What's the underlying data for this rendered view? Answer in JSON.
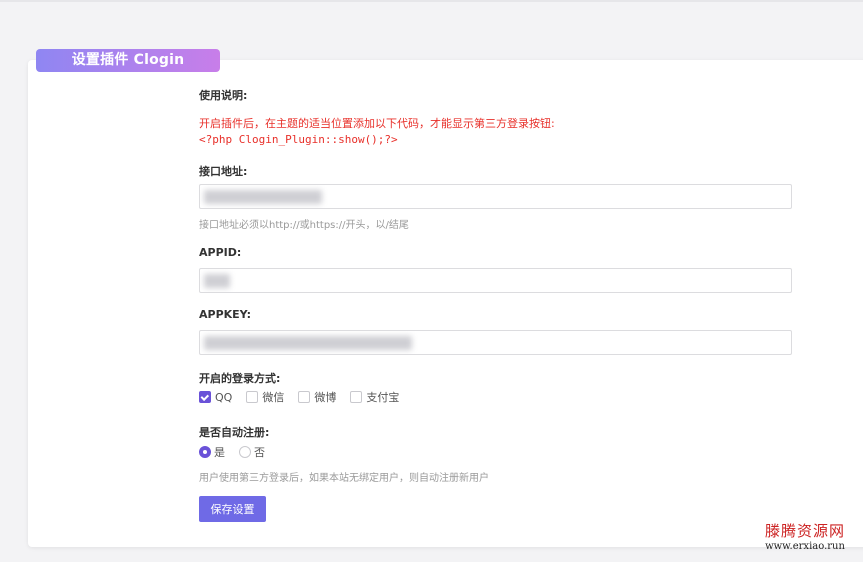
{
  "panel": {
    "title": "设置插件 Clogin"
  },
  "usage": {
    "label": "使用说明:",
    "notice": "开启插件后，在主题的适当位置添加以下代码，才能显示第三方登录按钮:",
    "code": "<?php Clogin_Plugin::show();?>"
  },
  "api_url": {
    "label": "接口地址:",
    "value": "",
    "help": "接口地址必须以http://或https://开头，以/结尾"
  },
  "appid": {
    "label": "APPID:",
    "value": ""
  },
  "appkey": {
    "label": "APPKEY:",
    "value": ""
  },
  "login_methods": {
    "label": "开启的登录方式:",
    "options": [
      {
        "label": "QQ",
        "checked": true
      },
      {
        "label": "微信",
        "checked": false
      },
      {
        "label": "微博",
        "checked": false
      },
      {
        "label": "支付宝",
        "checked": false
      }
    ]
  },
  "auto_register": {
    "label": "是否自动注册:",
    "options": [
      {
        "label": "是",
        "selected": true
      },
      {
        "label": "否",
        "selected": false
      }
    ],
    "help": "用户使用第三方登录后，如果本站无绑定用户，则自动注册新用户"
  },
  "save_button": {
    "label": "保存设置"
  },
  "watermark": {
    "name": "滕腾资源网",
    "url": "www.erxiao.run"
  },
  "colors": {
    "accent": "#6a52d8",
    "button": "#6f6ae6",
    "notice": "#e8302a"
  }
}
